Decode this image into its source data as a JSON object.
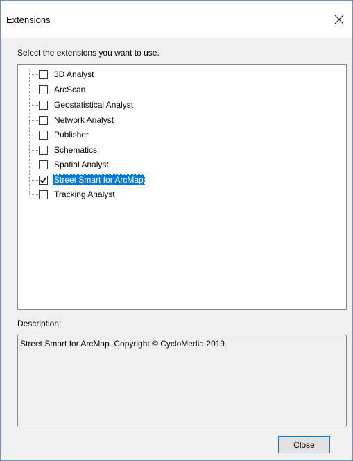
{
  "window": {
    "title": "Extensions"
  },
  "prompt": "Select the extensions you want to use.",
  "extensions": [
    {
      "label": "3D Analyst",
      "checked": false,
      "selected": false
    },
    {
      "label": "ArcScan",
      "checked": false,
      "selected": false
    },
    {
      "label": "Geostatistical Analyst",
      "checked": false,
      "selected": false
    },
    {
      "label": "Network Analyst",
      "checked": false,
      "selected": false
    },
    {
      "label": "Publisher",
      "checked": false,
      "selected": false
    },
    {
      "label": "Schematics",
      "checked": false,
      "selected": false
    },
    {
      "label": "Spatial Analyst",
      "checked": false,
      "selected": false
    },
    {
      "label": "Street Smart for ArcMap",
      "checked": true,
      "selected": true
    },
    {
      "label": "Tracking Analyst",
      "checked": false,
      "selected": false
    }
  ],
  "description": {
    "label": "Description:",
    "text": "Street Smart for ArcMap. Copyright © CycloMedia 2019."
  },
  "buttons": {
    "close_label": "Close"
  },
  "icons": {
    "close_window": "close-x-icon",
    "check": "checkmark-icon"
  },
  "colors": {
    "selection": "#0078d7",
    "window_border": "#6f8fc7",
    "dialog_bg": "#f0f0f0"
  }
}
